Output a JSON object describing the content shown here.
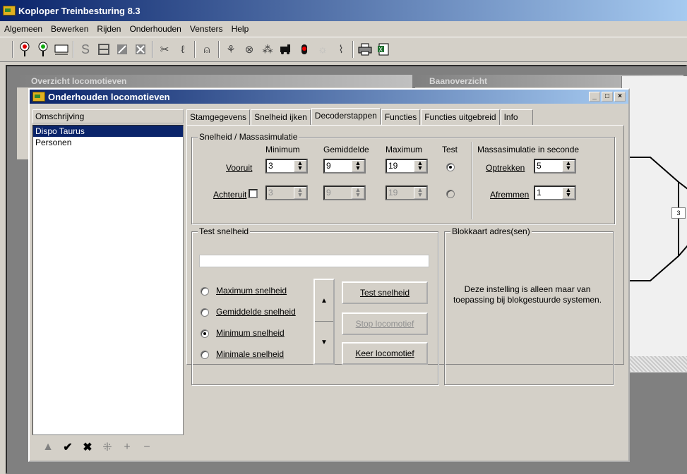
{
  "app": {
    "title": "Koploper Treinbesturing 8.3"
  },
  "menu": [
    "Algemeen",
    "Bewerken",
    "Rijden",
    "Onderhouden",
    "Vensters",
    "Help"
  ],
  "toolbar_icons": [
    "signal-red-icon",
    "signal-green-icon",
    "block-icon",
    "s-icon",
    "track-icon",
    "edit-icon",
    "grid-icon",
    "tools-icon",
    "curve-icon",
    "bell-icon",
    "route-icon",
    "shield-icon",
    "gear-icon",
    "train-icon",
    "red-light-icon",
    "sun-icon",
    "cable-icon",
    "print-icon",
    "excel-icon"
  ],
  "background_windows": {
    "left_title": "Overzicht locomotieven",
    "right_title": "Baanoverzicht",
    "right_number": "3"
  },
  "window": {
    "title": "Onderhouden locomotieven"
  },
  "list": {
    "header": "Omschrijving",
    "items": [
      "Dispo Taurus",
      "Personen"
    ],
    "selected_index": 0
  },
  "navbar": [
    "▲",
    "✔",
    "✖",
    "⁜",
    "+",
    "−"
  ],
  "tabs": [
    "Stamgegevens",
    "Snelheid ijken",
    "Decoderstappen",
    "Functies",
    "Functies uitgebreid",
    "Info"
  ],
  "active_tab": "Decoderstappen",
  "speed": {
    "group_title": "Snelheid / Massasimulatie",
    "col_min": "Minimum",
    "col_avg": "Gemiddelde",
    "col_max": "Maximum",
    "col_test": "Test",
    "row_forward": "Vooruit",
    "row_backward": "Achteruit",
    "forward": {
      "min": "3",
      "avg": "9",
      "max": "19"
    },
    "backward": {
      "min": "3",
      "avg": "9",
      "max": "19"
    },
    "mass_title": "Massasimulatie in seconde",
    "accelerate_label": "Optrekken",
    "accelerate_value": "5",
    "brake_label": "Afremmen",
    "brake_value": "1"
  },
  "test": {
    "group_title": "Test snelheid",
    "options": [
      "Maximum snelheid",
      "Gemiddelde snelheid",
      "Minimum snelheid",
      "Minimale snelheid"
    ],
    "selected_option": 2,
    "btn_test": "Test snelheid",
    "btn_stop": "Stop locomotief",
    "btn_reverse": "Keer locomotief"
  },
  "blokkaart": {
    "group_title": "Blokkaart adres(sen)",
    "text": "Deze instelling is alleen maar van toepassing bij blokgestuurde systemen."
  }
}
